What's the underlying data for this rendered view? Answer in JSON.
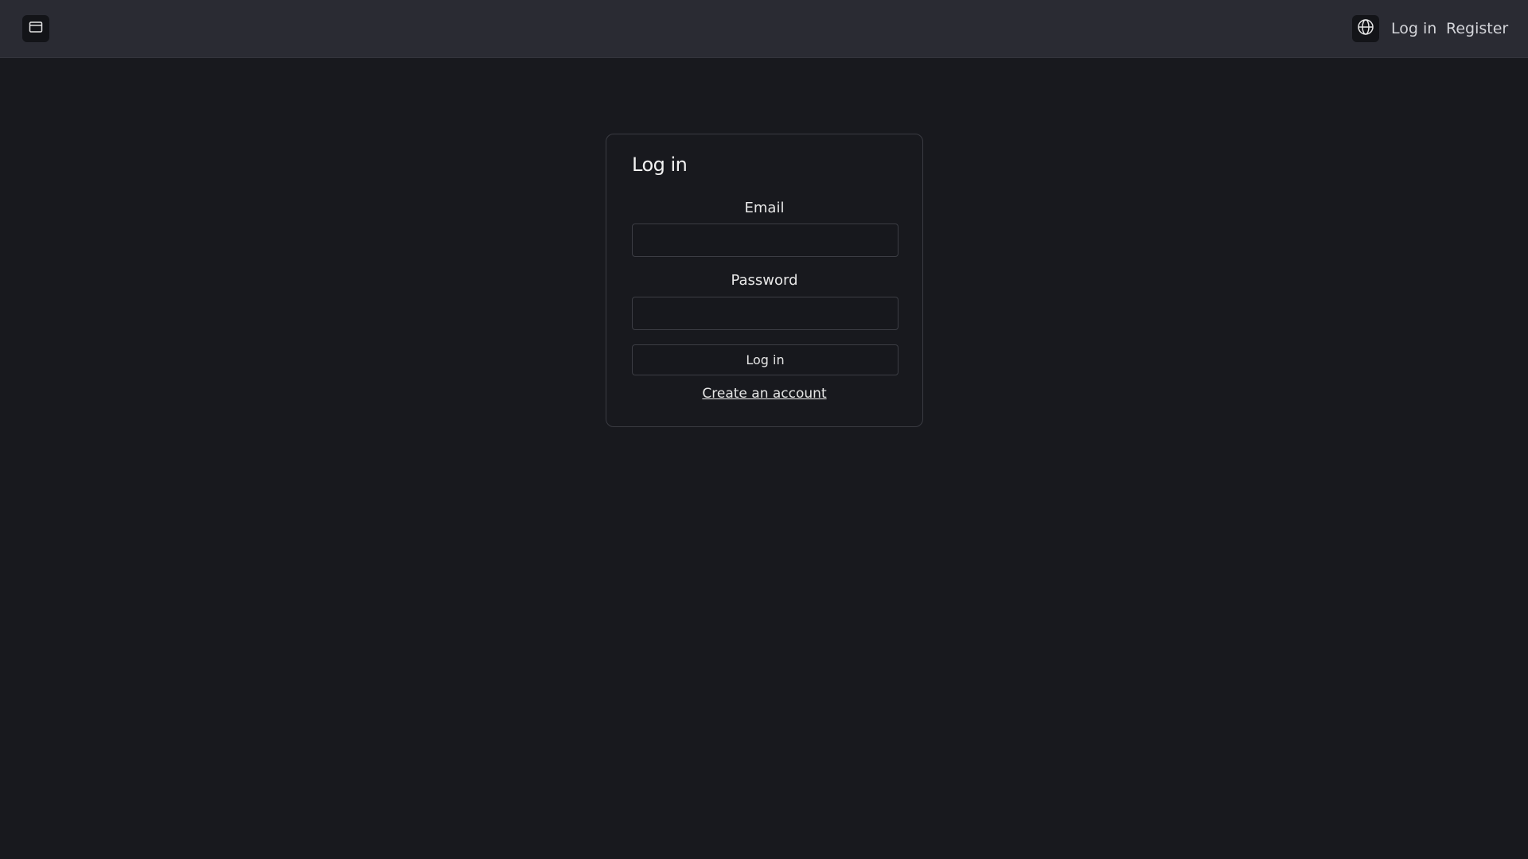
{
  "header": {
    "sidebar_toggle_icon": "window-icon",
    "language_icon": "globe-icon",
    "login_label": "Log in",
    "register_label": "Register"
  },
  "login_card": {
    "title": "Log in",
    "email_label": "Email",
    "email_value": "",
    "password_label": "Password",
    "password_value": "",
    "submit_label": "Log in",
    "create_account_label": "Create an account"
  },
  "colors": {
    "background": "#18191e",
    "topbar": "#2a2b33",
    "border": "#3c3d44",
    "text": "#e6e6e6"
  }
}
